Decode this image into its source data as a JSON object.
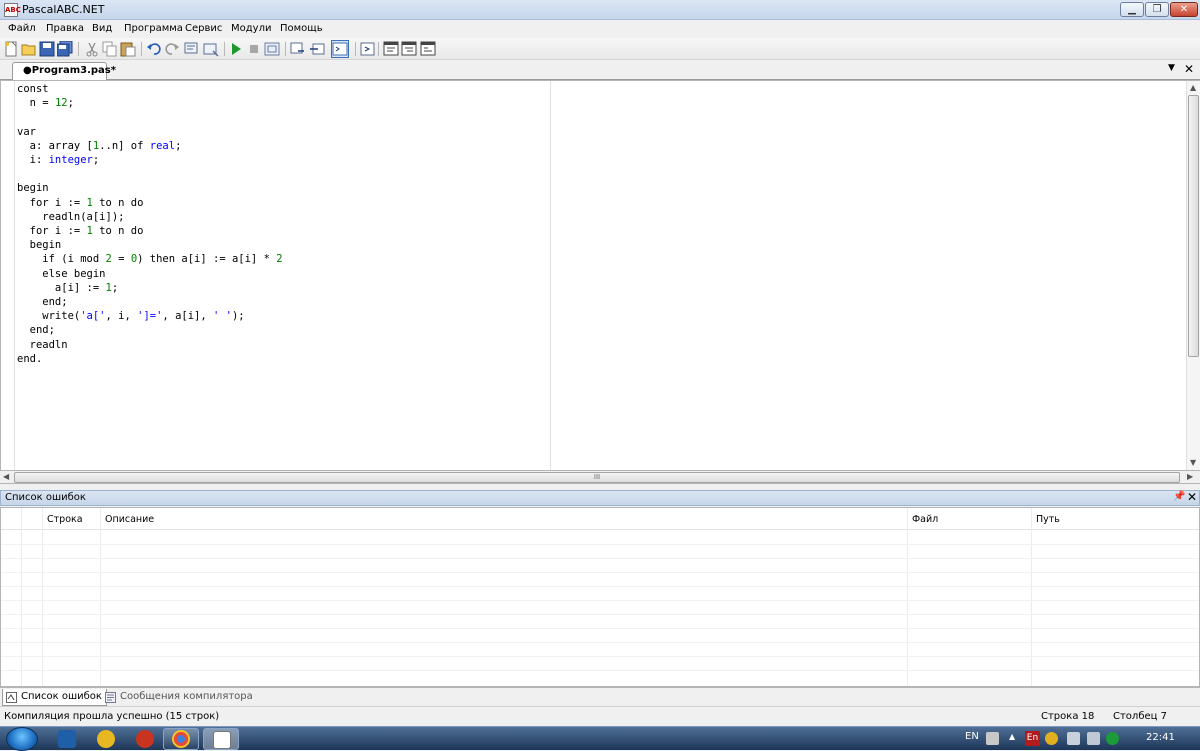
{
  "window": {
    "title": "PascalABC.NET",
    "icon_label": "ABC"
  },
  "menu": [
    "Файл",
    "Правка",
    "Вид",
    "Программа",
    "Сервис",
    "Модули",
    "Помощь"
  ],
  "toolbar": {
    "icons": [
      "new-file-icon",
      "open-icon",
      "save-icon",
      "save-all-icon",
      "cut-icon",
      "copy-icon",
      "paste-icon",
      "undo-icon",
      "redo-icon",
      "find-icon",
      "replace-icon",
      "run-icon",
      "stop-icon",
      "compile-icon",
      "step-over-icon",
      "step-into-icon",
      "output-window-icon",
      "goto-icon",
      "format-icon",
      "breakpoint-icon",
      "watch-icon"
    ]
  },
  "document_tab": {
    "label": "●Program3.pas*"
  },
  "editor": {
    "lines": [
      "const",
      "  n = 12;",
      "",
      "var",
      "  a: array [1..n] of real;",
      "  i: integer;",
      "",
      "begin",
      "  for i := 1 to n do",
      "    readln(a[i]);",
      "  for i := 1 to n do",
      "  begin",
      "    if (i mod 2 = 0) then a[i] := a[i] * 2",
      "    else begin",
      "      a[i] := 1;",
      "    end;",
      "    write('a[', i, ']=', a[i], ' ');",
      "  end;",
      "  readln",
      "end."
    ],
    "hscroll_grip": "III"
  },
  "error_panel": {
    "title": "Список ошибок",
    "columns": [
      "Строка",
      "Описание",
      "Файл",
      "Путь"
    ]
  },
  "bottom_tabs": {
    "errors": "Список ошибок",
    "compiler": "Сообщения компилятора"
  },
  "status": {
    "message": "Компиляция прошла успешно (15 строк)",
    "row": "Строка  18",
    "column": "Столбец  7"
  },
  "taskbar": {
    "lang": "EN",
    "lang_badge": "En",
    "clock": "22:41"
  }
}
